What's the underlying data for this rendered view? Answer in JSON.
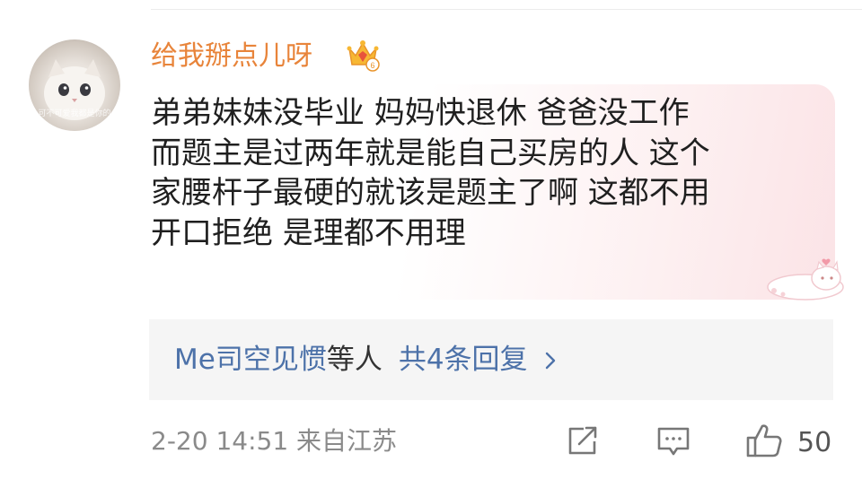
{
  "comment": {
    "username": "给我掰点儿呀",
    "avatar_caption": "可不可爱我都是你的",
    "icon": "vip-crown-badge",
    "content_lines": [
      "弟弟妹妹没毕业 妈妈快退休 爸爸没工作",
      "而题主是过两年就是能自己买房的人  这个",
      "家腰杆子最硬的就该是题主了啊 这都不用",
      "开口拒绝 是理都不用理"
    ],
    "replies": {
      "users": "Me司空见惯",
      "suffix": "等人",
      "count_label": "共4条回复"
    },
    "timestamp": "2-20 14:51 来自江苏",
    "like_count": "50"
  },
  "colors": {
    "username": "#e8843a",
    "link": "#4d72a9",
    "meta": "#8a8a8a",
    "reply_bg": "#f5f5f5"
  }
}
